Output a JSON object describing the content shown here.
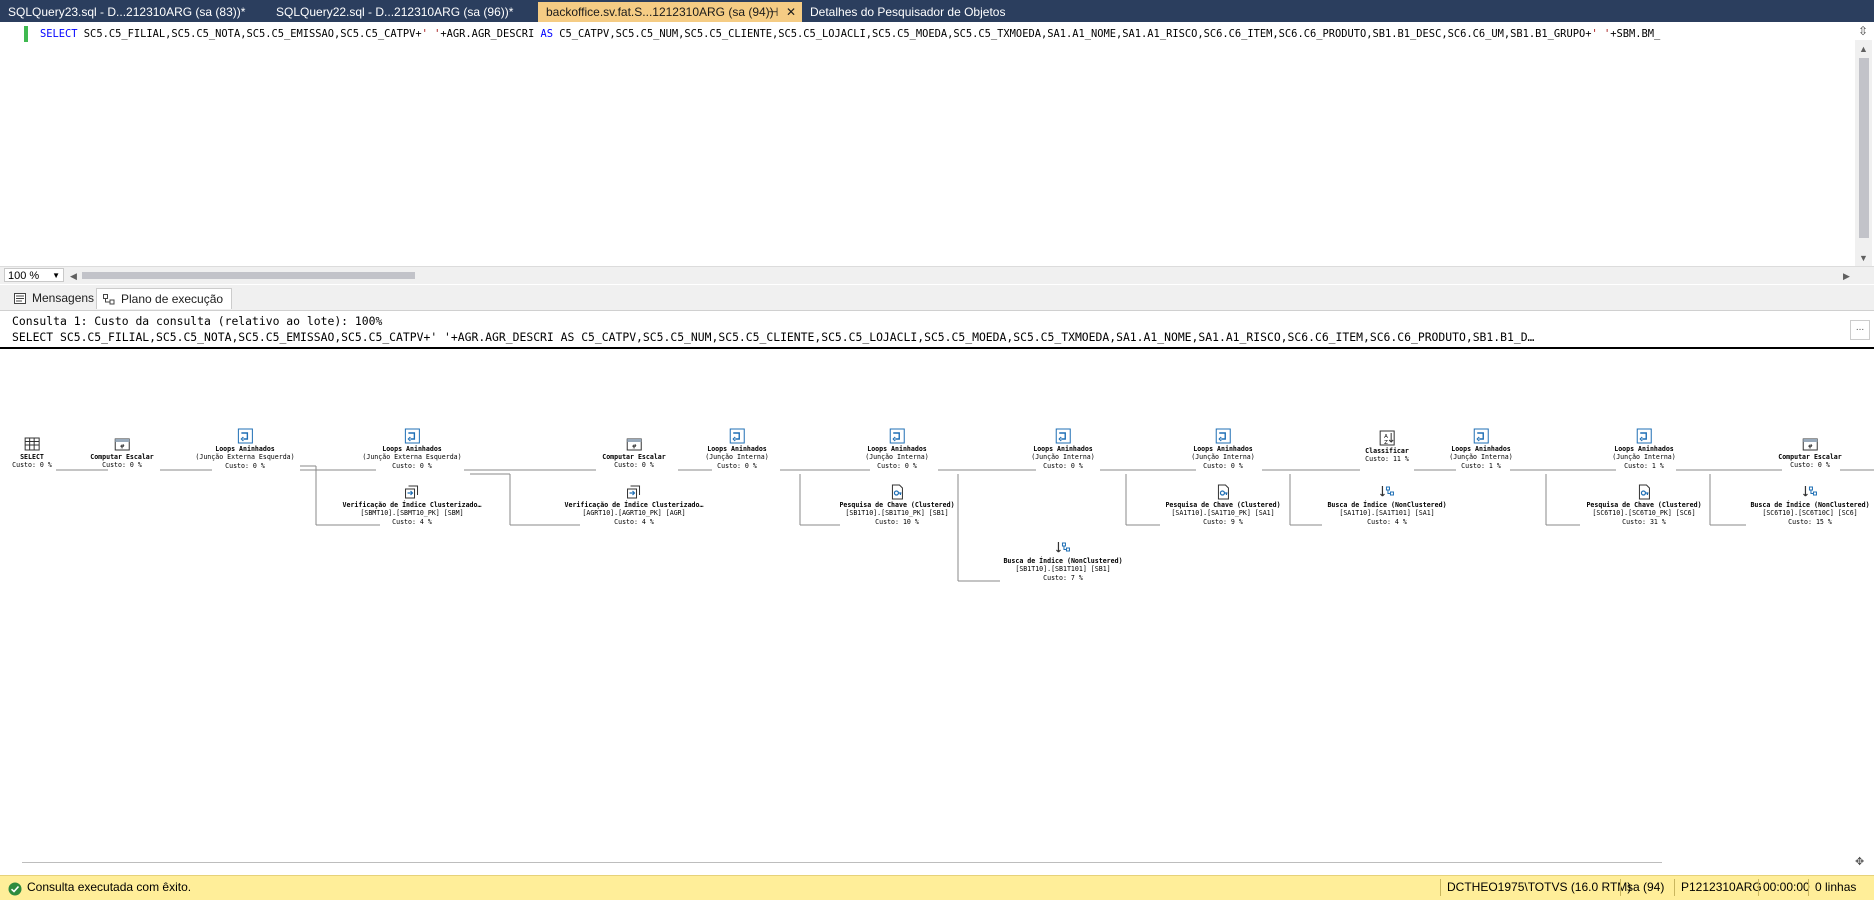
{
  "tabs": [
    {
      "label": "SQLQuery23.sql - D...212310ARG (sa (83))*",
      "active": false
    },
    {
      "label": "SQLQuery22.sql - D...212310ARG (sa (96))*",
      "active": false
    },
    {
      "label": "backoffice.sv.fat.S...1212310ARG (sa (94))",
      "active": true
    },
    {
      "label": "Detalhes do Pesquisador de Objetos",
      "active": false
    }
  ],
  "tab_pin": "⊣",
  "tab_close": "✕",
  "editor": {
    "keyword_select": "SELECT",
    "sql_part1": " SC5.C5_FILIAL,SC5.C5_NOTA,SC5.C5_EMISSAO,SC5.C5_CATPV+",
    "sql_string": "' '",
    "sql_part2": "+AGR.AGR_DESCRI ",
    "keyword_as": "AS",
    "sql_part3": " C5_CATPV,SC5.C5_NUM,SC5.C5_CLIENTE,SC5.C5_LOJACLI,SC5.C5_MOEDA,SC5.C5_TXMOEDA,SA1.A1_NOME,SA1.A1_RISCO,SC6.C6_ITEM,SC6.C6_PRODUTO,SB1.B1_DESC,SC6.C6_UM,SB1.B1_GRUPO+",
    "sql_string2": "' '",
    "sql_part4": "+SBM.BM_"
  },
  "zoom": "100 %",
  "results_tabs": [
    {
      "label": "Mensagens",
      "icon": "messages-icon"
    },
    {
      "label": "Plano de execução",
      "icon": "execution-plan-icon"
    }
  ],
  "plan_header": {
    "line1": "Consulta 1: Custo da consulta (relativo ao lote): 100%",
    "line2": "SELECT SC5.C5_FILIAL,SC5.C5_NOTA,SC5.C5_EMISSAO,SC5.C5_CATPV+' '+AGR.AGR_DESCRI AS C5_CATPV,SC5.C5_NUM,SC5.C5_CLIENTE,SC5.C5_LOJACLI,SC5.C5_MOEDA,SC5.C5_TXMOEDA,SA1.A1_NOME,SA1.A1_RISCO,SC6.C6_ITEM,SC6.C6_PRODUTO,SB1.B1_D…"
  },
  "more_button": "...",
  "plan_nodes": [
    {
      "id": "select",
      "icon": "select-icon",
      "title": "SELECT",
      "sub": "",
      "sub2": "",
      "cost": "Custo: 0 %"
    },
    {
      "id": "compute1",
      "icon": "compute-scalar-icon",
      "title": "Computar Escalar",
      "sub": "",
      "sub2": "",
      "cost": "Custo: 0 %"
    },
    {
      "id": "loops1",
      "icon": "nested-loops-icon",
      "title": "Loops Aninhados",
      "sub": "(Junção Externa Esquerda)",
      "sub2": "",
      "cost": "Custo: 0 %"
    },
    {
      "id": "loops2",
      "icon": "nested-loops-icon",
      "title": "Loops Aninhados",
      "sub": "(Junção Externa Esquerda)",
      "sub2": "",
      "cost": "Custo: 0 %"
    },
    {
      "id": "scan_sbm",
      "icon": "clustered-index-scan-icon",
      "title": "Verificação de Índice Clusterizado…",
      "sub": "[SBMT10].[SBMT10_PK] [SBM]",
      "sub2": "",
      "cost": "Custo: 4 %"
    },
    {
      "id": "compute2",
      "icon": "compute-scalar-icon",
      "title": "Computar Escalar",
      "sub": "",
      "sub2": "",
      "cost": "Custo: 0 %"
    },
    {
      "id": "scan_agr",
      "icon": "clustered-index-scan-icon",
      "title": "Verificação de Índice Clusterizado…",
      "sub": "[AGRT10].[AGRT10_PK] [AGR]",
      "sub2": "",
      "cost": "Custo: 4 %"
    },
    {
      "id": "loops3",
      "icon": "nested-loops-icon",
      "title": "Loops Aninhados",
      "sub": "(Junção Interna)",
      "sub2": "",
      "cost": "Custo: 0 %"
    },
    {
      "id": "loops4",
      "icon": "nested-loops-icon",
      "title": "Loops Aninhados",
      "sub": "(Junção Interna)",
      "sub2": "",
      "cost": "Custo: 0 %"
    },
    {
      "id": "lookup_sb1",
      "icon": "key-lookup-icon",
      "title": "Pesquisa de Chave (Clustered)",
      "sub": "[SB1T10].[SB1T10_PK] [SB1]",
      "sub2": "",
      "cost": "Custo: 10 %"
    },
    {
      "id": "loops5",
      "icon": "nested-loops-icon",
      "title": "Loops Aninhados",
      "sub": "(Junção Interna)",
      "sub2": "",
      "cost": "Custo: 0 %"
    },
    {
      "id": "seek_sb1",
      "icon": "index-seek-icon",
      "title": "Busca de Índice (NonClustered)",
      "sub": "[SB1T10].[SB1T101] [SB1]",
      "sub2": "",
      "cost": "Custo: 7 %"
    },
    {
      "id": "loops6",
      "icon": "nested-loops-icon",
      "title": "Loops Aninhados",
      "sub": "(Junção Interna)",
      "sub2": "",
      "cost": "Custo: 0 %"
    },
    {
      "id": "lookup_sa1",
      "icon": "key-lookup-icon",
      "title": "Pesquisa de Chave (Clustered)",
      "sub": "[SA1T10].[SA1T10_PK] [SA1]",
      "sub2": "",
      "cost": "Custo: 9 %"
    },
    {
      "id": "sort",
      "icon": "sort-icon",
      "title": "Classificar",
      "sub": "",
      "sub2": "",
      "cost": "Custo: 11 %"
    },
    {
      "id": "seek_sa1",
      "icon": "index-seek-icon",
      "title": "Busca de Índice (NonClustered)",
      "sub": "[SA1T10].[SA1T101] [SA1]",
      "sub2": "",
      "cost": "Custo: 4 %"
    },
    {
      "id": "loops7",
      "icon": "nested-loops-icon",
      "title": "Loops Aninhados",
      "sub": "(Junção Interna)",
      "sub2": "",
      "cost": "Custo: 1 %"
    },
    {
      "id": "loops8",
      "icon": "nested-loops-icon",
      "title": "Loops Aninhados",
      "sub": "(Junção Interna)",
      "sub2": "",
      "cost": "Custo: 1 %"
    },
    {
      "id": "lookup_sc6",
      "icon": "key-lookup-icon",
      "title": "Pesquisa de Chave (Clustered)",
      "sub": "[SC6T10].[SC6T10_PK] [SC6]",
      "sub2": "",
      "cost": "Custo: 31 %"
    },
    {
      "id": "compute3",
      "icon": "compute-scalar-icon",
      "title": "Computar Escalar",
      "sub": "",
      "sub2": "",
      "cost": "Custo: 0 %"
    },
    {
      "id": "seek_sc6",
      "icon": "index-seek-icon",
      "title": "Busca de Índice (NonClustered)",
      "sub": "[SC6T10].[SC6T10C] [SC6]",
      "sub2": "",
      "cost": "Custo: 15 %"
    }
  ],
  "status": {
    "message": "Consulta executada com êxito.",
    "server": "DCTHEO1975\\TOTVS (16.0 RTM)",
    "user": "sa (94)",
    "database": "P1212310ARG",
    "elapsed": "00:00:00",
    "rows": "0 linhas"
  },
  "colors": {
    "tabstrip": "#2b3e5e",
    "active_tab": "#f5cc84",
    "statusbar": "#ffee99",
    "keyword": "#0000ff",
    "string": "#a31515",
    "plan_icon": "#1f6fb5"
  }
}
